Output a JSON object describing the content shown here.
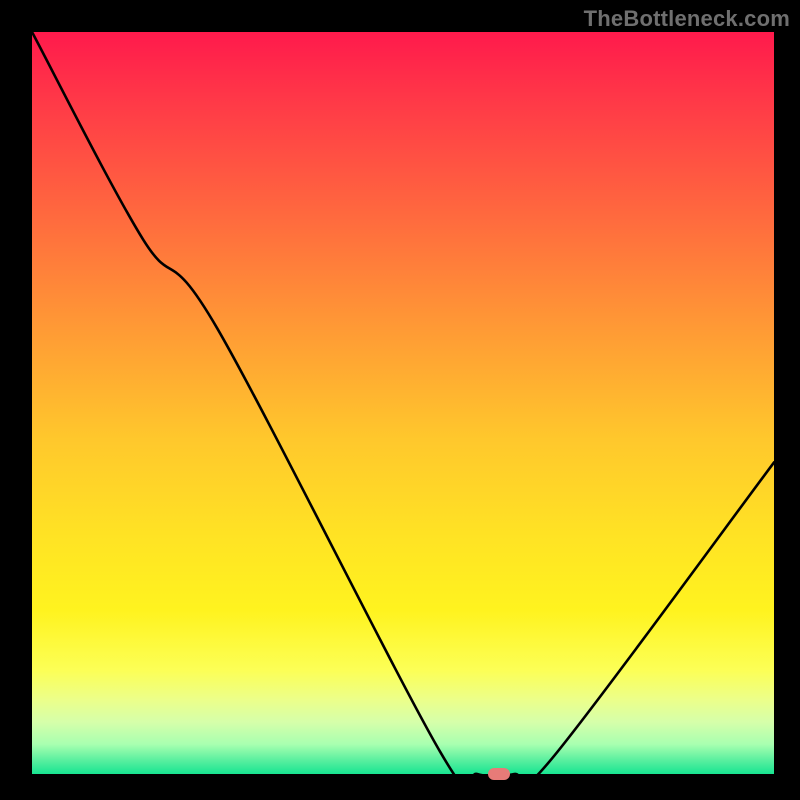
{
  "watermark": "TheBottleneck.com",
  "chart_data": {
    "type": "line",
    "title": "",
    "xlabel": "",
    "ylabel": "",
    "xlim": [
      0,
      100
    ],
    "ylim": [
      0,
      100
    ],
    "x": [
      0,
      15,
      25,
      55,
      60,
      65,
      70,
      100
    ],
    "values": [
      100,
      72,
      60,
      3,
      0,
      0,
      2,
      42
    ],
    "marker": {
      "x": 63,
      "y": 0
    },
    "gradient_stops": [
      {
        "pos": 0,
        "color": "#ff1a4c"
      },
      {
        "pos": 25,
        "color": "#ff6a3e"
      },
      {
        "pos": 55,
        "color": "#ffc82c"
      },
      {
        "pos": 78,
        "color": "#fff31f"
      },
      {
        "pos": 93,
        "color": "#d6ffaa"
      },
      {
        "pos": 100,
        "color": "#18e592"
      }
    ]
  }
}
